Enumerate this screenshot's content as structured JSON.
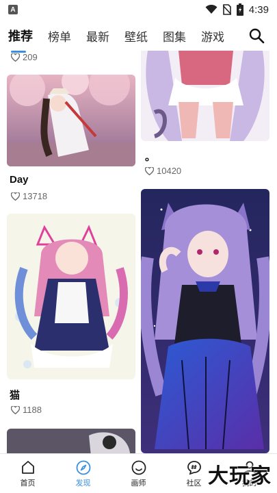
{
  "status_bar": {
    "app_indicator": "A",
    "time": "4:39"
  },
  "top_tabs": [
    {
      "label": "推荐",
      "active": true
    },
    {
      "label": "榜单",
      "active": false
    },
    {
      "label": "最新",
      "active": false
    },
    {
      "label": "壁纸",
      "active": false
    },
    {
      "label": "图集",
      "active": false
    },
    {
      "label": "游戏",
      "active": false
    }
  ],
  "feed": {
    "left": [
      {
        "likes": "209"
      },
      {
        "title": "Day",
        "likes": "13718",
        "image": "anime-girl-cherry-blossom-art"
      },
      {
        "title": "猫",
        "likes": "1188",
        "image": "anime-maid-girl-pink-hair-art"
      },
      {
        "image": "anime-girl-silver-hair-art"
      }
    ],
    "right": [
      {
        "title": "。",
        "likes": "10420",
        "image": "anime-girl-lavender-outfit-art"
      },
      {
        "image": "anime-girl-purple-hair-cat-ears-art"
      }
    ]
  },
  "bottom_nav": [
    {
      "label": "首页",
      "icon": "home-icon",
      "active": false
    },
    {
      "label": "发现",
      "icon": "compass-icon",
      "active": true
    },
    {
      "label": "画师",
      "icon": "smile-face-icon",
      "active": false
    },
    {
      "label": "社区",
      "icon": "chat-hash-icon",
      "active": false
    },
    {
      "label": "我的",
      "icon": "user-icon",
      "active": false
    }
  ],
  "watermark": "大玩家",
  "colors": {
    "accent": "#3a8fe0",
    "text": "#222222",
    "muted": "#666666"
  }
}
